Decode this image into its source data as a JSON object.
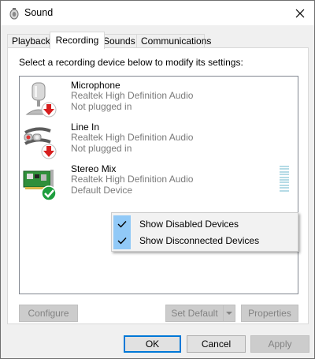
{
  "window": {
    "title": "Sound",
    "title_icon": "speaker-icon",
    "close_symbol": "✕"
  },
  "tabs": [
    {
      "label": "Playback",
      "active": false
    },
    {
      "label": "Recording",
      "active": true
    },
    {
      "label": "Sounds",
      "active": false
    },
    {
      "label": "Communications",
      "active": false
    }
  ],
  "panel": {
    "instruction": "Select a recording device below to modify its settings:"
  },
  "devices": [
    {
      "name": "Microphone",
      "driver": "Realtek High Definition Audio",
      "status": "Not plugged in",
      "icon": "microphone-icon",
      "badge": "red-down-arrow-badge"
    },
    {
      "name": "Line In",
      "driver": "Realtek High Definition Audio",
      "status": "Not plugged in",
      "icon": "line-in-cable-icon",
      "badge": "red-down-arrow-badge"
    },
    {
      "name": "Stereo Mix",
      "driver": "Realtek High Definition Audio",
      "status": "Default Device",
      "icon": "sound-card-icon",
      "badge": "green-check-badge",
      "has_level_meter": true
    }
  ],
  "context_menu": {
    "items": [
      {
        "label": "Show Disabled Devices",
        "checked": true
      },
      {
        "label": "Show Disconnected Devices",
        "checked": true
      }
    ]
  },
  "panel_buttons": {
    "configure": "Configure",
    "set_default": "Set Default",
    "properties": "Properties"
  },
  "dialog_buttons": {
    "ok": "OK",
    "cancel": "Cancel",
    "apply": "Apply"
  },
  "colors": {
    "accent": "#0078d7",
    "menu_highlight": "#91c9f7",
    "level_meter": "#b5dbe6",
    "disabled_text": "#838383",
    "secondary_text": "#7a7a7a"
  }
}
